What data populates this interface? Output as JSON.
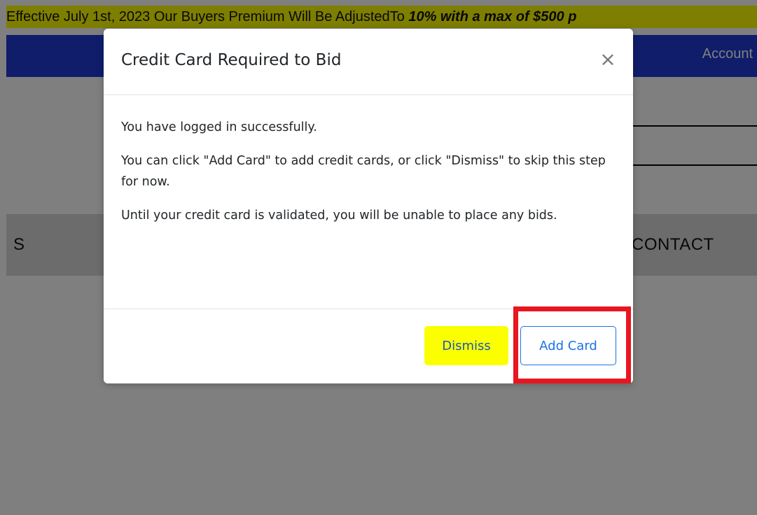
{
  "announcement": {
    "text_prefix": "Effective July 1st, 2023 Our Buyers Premium Will Be AdjustedTo ",
    "text_emphasis": "10% with a max of $500 p"
  },
  "navbar": {
    "account_label": "Account",
    "background_color": "#1f3bd6"
  },
  "menu": {
    "left_partial_label": "S",
    "contact_label": "CONTACT"
  },
  "modal": {
    "title": "Credit Card Required to Bid",
    "close_symbol": "×",
    "body": [
      "You have logged in successfully.",
      "You can click \"Add Card\" to add credit cards, or click \"Dismiss\" to skip this step for now.",
      "Until your credit card is validated, you will be unable to place any bids."
    ],
    "dismiss_label": "Dismiss",
    "add_card_label": "Add Card"
  },
  "colors": {
    "dismiss_bg": "#fbff00",
    "add_card_border": "#1a73e8",
    "highlight": "#e8161f",
    "announcement_bg": "#fdfd00"
  }
}
